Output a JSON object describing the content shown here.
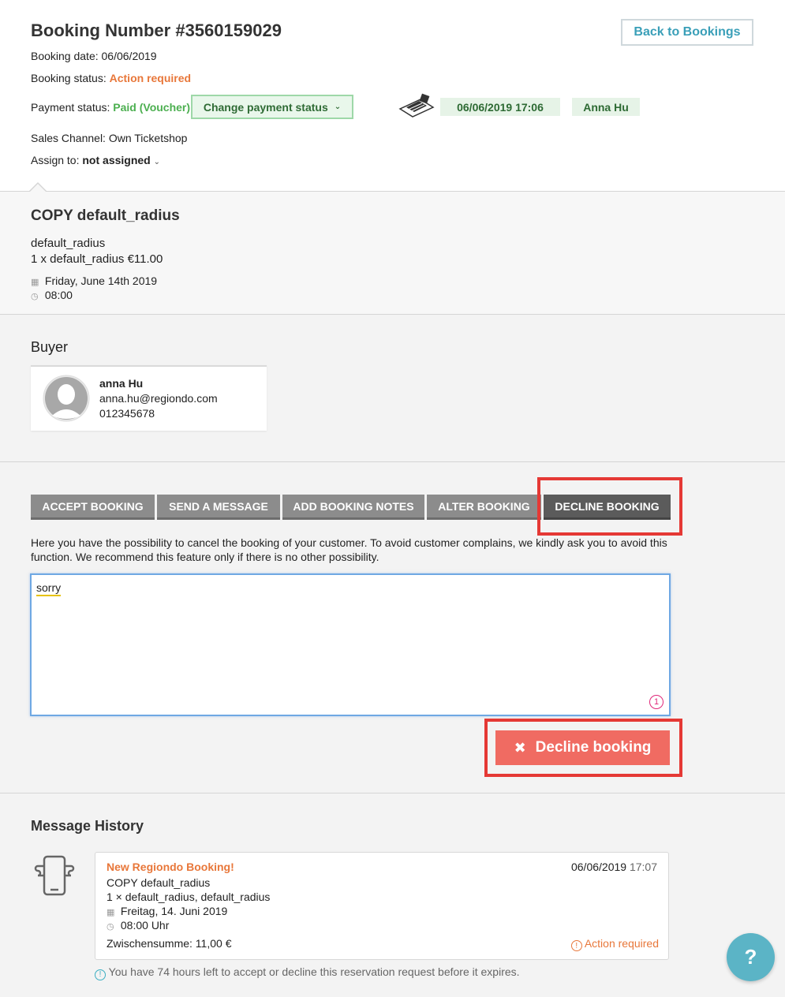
{
  "header": {
    "title": "Booking Number #3560159029",
    "back_label": "Back to Bookings",
    "booking_date_label": "Booking date:",
    "booking_date": "06/06/2019",
    "status_label": "Booking status:",
    "status_value": "Action required",
    "payment_label": "Payment status:",
    "payment_value": "Paid (Voucher)",
    "change_payment_label": "Change payment status",
    "timestamp": "06/06/2019 17:06",
    "user": "Anna Hu",
    "sales_channel": "Sales Channel: Own Ticketshop",
    "assign_label": "Assign to:",
    "assign_value": "not assigned"
  },
  "product": {
    "title": "COPY default_radius",
    "name": "default_radius",
    "line": "1 x default_radius €11.00",
    "date": "Friday, June 14th 2019",
    "time": "08:00"
  },
  "buyer": {
    "heading": "Buyer",
    "name": "anna Hu",
    "email": "anna.hu@regiondo.com",
    "phone": "012345678"
  },
  "tabs": [
    {
      "label": "ACCEPT BOOKING"
    },
    {
      "label": "SEND A MESSAGE"
    },
    {
      "label": "ADD BOOKING NOTES"
    },
    {
      "label": "ALTER BOOKING"
    },
    {
      "label": "DECLINE BOOKING"
    }
  ],
  "decline": {
    "info": "Here you have the possibility to cancel the booking of your customer. To avoid customer complains, we kindly ask you to avoid this function. We recommend this feature only if there is no other possibility.",
    "textarea_value": "sorry",
    "counter": "1",
    "button_label": "Decline booking"
  },
  "history": {
    "heading": "Message History",
    "msg_title": "New Regiondo Booking!",
    "msg_date": "06/06/2019",
    "msg_time": "17:07",
    "msg_product": "COPY default_radius",
    "msg_line": "1 × default_radius, default_radius",
    "msg_day": "Freitag, 14. Juni 2019",
    "msg_hour": "08:00 Uhr",
    "msg_subtotal": "Zwischensumme: 11,00 €",
    "msg_status": "Action required",
    "expiry_note": "You have 74 hours left to accept or decline this reservation request before it expires."
  },
  "help": {
    "label": "?"
  },
  "colors": {
    "accent": "#3a9fb8",
    "orange": "#e8773a",
    "green": "#4caf50",
    "danger": "#f06b62",
    "highlight": "#e53935"
  }
}
